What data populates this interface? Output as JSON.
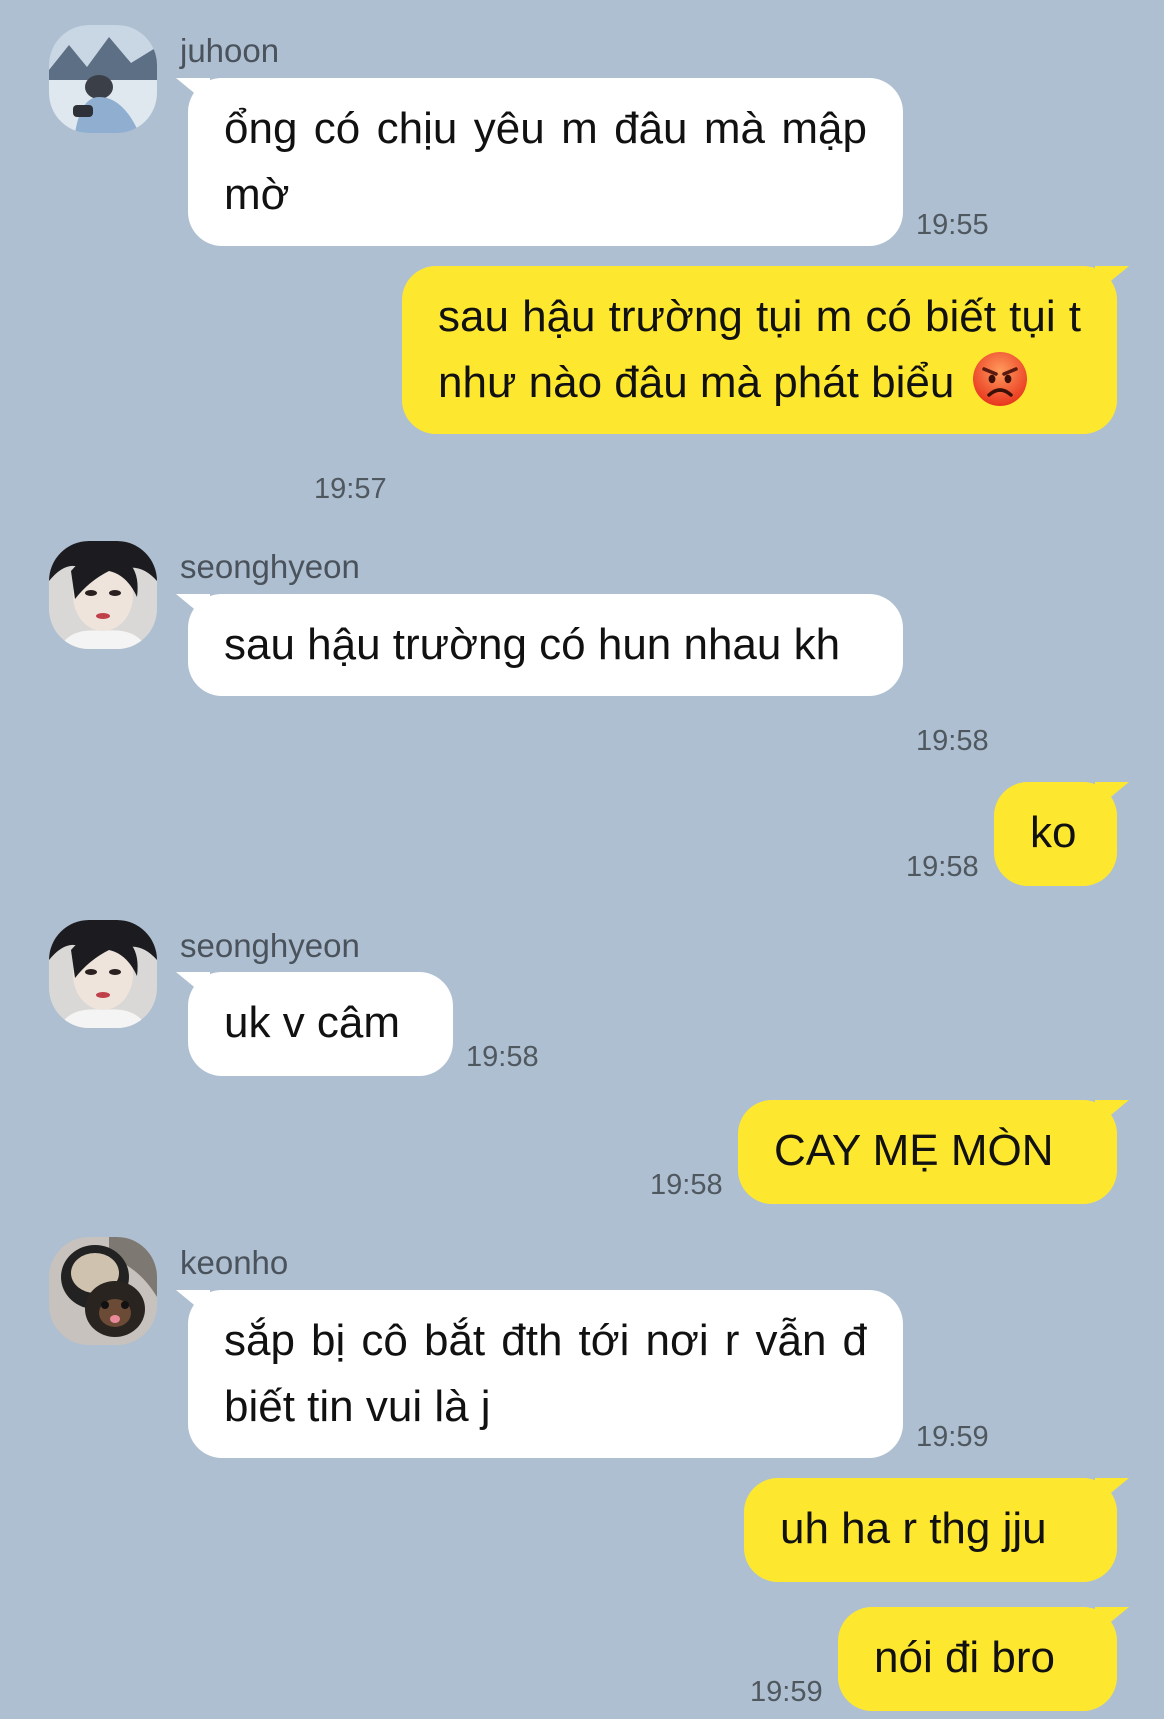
{
  "messages": [
    {
      "type": "in",
      "sender": "juhoon",
      "avatar_icon": "juhoon-avatar",
      "text": "ổng có chịu yêu m đâu mà mập mờ",
      "time": "19:55"
    },
    {
      "type": "out",
      "text": "sau hậu trường tụi m có biết tụi t như nào đâu mà phát biểu",
      "emoji": "angry-face-emoji",
      "time": "19:57"
    },
    {
      "type": "in",
      "sender": "seonghyeon",
      "avatar_icon": "seonghyeon-avatar",
      "text": "sau hậu trường có hun nhau kh",
      "time": "19:58"
    },
    {
      "type": "out",
      "text": "ko",
      "time": "19:58"
    },
    {
      "type": "in",
      "sender": "seonghyeon",
      "avatar_icon": "seonghyeon-avatar",
      "text": "uk v câm",
      "time": "19:58"
    },
    {
      "type": "out",
      "text": "CAY MẸ MÒN",
      "time": "19:58"
    },
    {
      "type": "in",
      "sender": "keonho",
      "avatar_icon": "keonho-avatar",
      "text": "sắp bị cô bắt đth tới nơi r vẫn đ biết tin vui là j",
      "time": "19:59"
    },
    {
      "type": "out",
      "text": "uh ha r thg jju",
      "time": ""
    },
    {
      "type": "out",
      "text": "nói đi bro",
      "time": "19:59"
    }
  ],
  "colors": {
    "background": "#aebfd1",
    "incoming_bubble": "#ffffff",
    "outgoing_bubble": "#fee82f",
    "time_text": "#50585f",
    "sender_text": "#4a525b"
  }
}
